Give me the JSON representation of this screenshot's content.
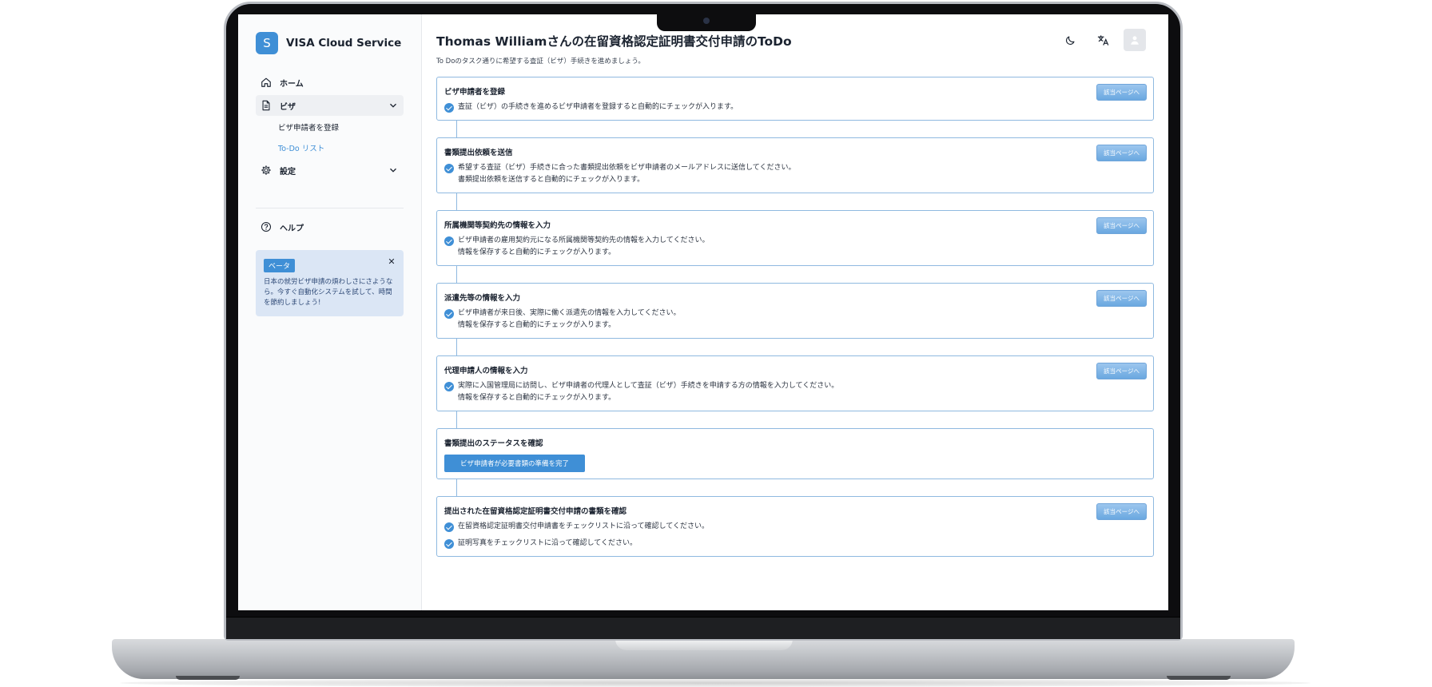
{
  "app": {
    "brand_letter": "S",
    "brand_name": "VISA Cloud Service"
  },
  "sidebar": {
    "items": [
      {
        "label": "ホーム",
        "icon": "home-icon"
      },
      {
        "label": "ビザ",
        "icon": "document-icon",
        "expanded": true
      },
      {
        "label": "設定",
        "icon": "gear-icon"
      }
    ],
    "visa_sub": [
      {
        "label": "ビザ申請者を登録"
      },
      {
        "label": "To-Do リスト",
        "current": true
      }
    ],
    "help_label": "ヘルプ",
    "beta": {
      "badge": "ベータ",
      "close": "✕",
      "text": "日本の就労ビザ申請の煩わしさにさようなら。今すぐ自動化システムを試して、時間を節約しましょう!"
    }
  },
  "header": {
    "title": "Thomas Williamさんの在留資格認定証明書交付申請のToDo",
    "description": "To Doのタスク通りに希望する査証（ビザ）手続きを進めましょう。"
  },
  "colors": {
    "accent": "#3f8fd6",
    "card_border": "#8fb9e0",
    "beta_bg": "#dbe6f5"
  },
  "todos": [
    {
      "title": "ビザ申請者を登録",
      "button": "該当ページへ",
      "lines": [
        "査証（ビザ）の手続きを進めるビザ申請者を登録すると自動的にチェックが入ります。"
      ],
      "sub": ""
    },
    {
      "title": "書類提出依頼を送信",
      "button": "該当ページへ",
      "lines": [
        "希望する査証（ビザ）手続きに合った書類提出依頼をビザ申請者のメールアドレスに送信してください。"
      ],
      "sub": "書類提出依頼を送信すると自動的にチェックが入ります。"
    },
    {
      "title": "所属機関等契約先の情報を入力",
      "button": "該当ページへ",
      "lines": [
        "ビザ申請者の雇用契約元になる所属機関等契約先の情報を入力してください。"
      ],
      "sub": "情報を保存すると自動的にチェックが入ります。"
    },
    {
      "title": "派遣先等の情報を入力",
      "button": "該当ページへ",
      "lines": [
        "ビザ申請者が来日後、実際に働く派遣先の情報を入力してください。"
      ],
      "sub": "情報を保存すると自動的にチェックが入ります。"
    },
    {
      "title": "代理申請人の情報を入力",
      "button": "該当ページへ",
      "lines": [
        "実際に入国管理局に訪問し、ビザ申請者の代理人として査証（ビザ）手続きを申請する方の情報を入力してください。"
      ],
      "sub": "情報を保存すると自動的にチェックが入ります。"
    },
    {
      "title": "書類提出のステータスを確認",
      "status_button": "ビザ申請者が必要書類の準備を完了"
    },
    {
      "title": "提出された在留資格認定証明書交付申請の書類を確認",
      "button": "該当ページへ",
      "lines": [
        "在留資格認定証明書交付申請書をチェックリストに沿って確認してください。",
        "証明写真をチェックリストに沿って確認してください。"
      ],
      "sub": ""
    }
  ]
}
